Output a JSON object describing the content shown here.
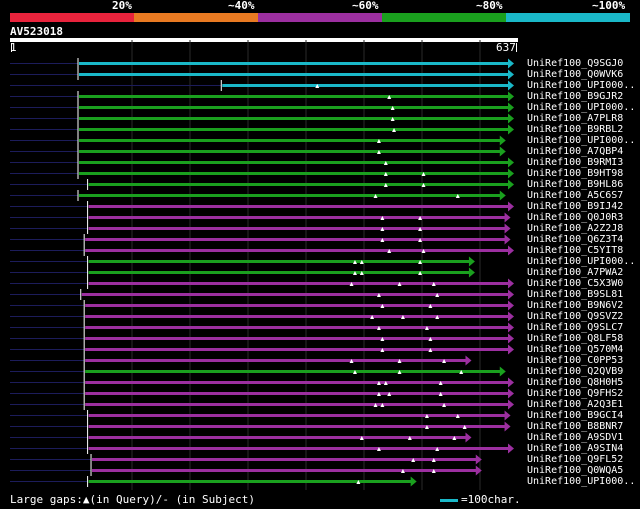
{
  "legend": {
    "labels": [
      "20%",
      "~40%",
      "~60%",
      "~80%",
      "~100%"
    ],
    "colors": [
      "#e8233c",
      "#e87a22",
      "#9c2fa0",
      "#1aa01e",
      "#1ab8c8"
    ]
  },
  "query": {
    "name": "AV523018",
    "start": "1",
    "end": "637"
  },
  "hits": [
    {
      "label": "UniRef100_Q9SGJ0",
      "color": "#1ab8c8",
      "start": 1,
      "end": 637,
      "marks": []
    },
    {
      "label": "UniRef100_Q0WVK6",
      "color": "#1ab8c8",
      "start": 1,
      "end": 637,
      "marks": []
    },
    {
      "label": "UniRef100_UPI000..",
      "color": "#1ab8c8",
      "start": 210,
      "end": 637,
      "marks": [
        350
      ]
    },
    {
      "label": "UniRef100_B9GJR2",
      "color": "#1aa01e",
      "start": 1,
      "end": 637,
      "marks": [
        455
      ]
    },
    {
      "label": "UniRef100_UPI000..",
      "color": "#1aa01e",
      "start": 1,
      "end": 637,
      "marks": [
        460
      ]
    },
    {
      "label": "UniRef100_A7PLR8",
      "color": "#1aa01e",
      "start": 1,
      "end": 637,
      "marks": [
        460
      ]
    },
    {
      "label": "UniRef100_B9RBL2",
      "color": "#1aa01e",
      "start": 1,
      "end": 637,
      "marks": [
        462
      ]
    },
    {
      "label": "UniRef100_UPI000..",
      "color": "#1aa01e",
      "start": 1,
      "end": 625,
      "marks": [
        440
      ]
    },
    {
      "label": "UniRef100_A7QBP4",
      "color": "#1aa01e",
      "start": 1,
      "end": 625,
      "marks": [
        440
      ]
    },
    {
      "label": "UniRef100_B9RMI3",
      "color": "#1aa01e",
      "start": 1,
      "end": 637,
      "marks": [
        450
      ]
    },
    {
      "label": "UniRef100_B9HT98",
      "color": "#1aa01e",
      "start": 1,
      "end": 637,
      "marks": [
        450,
        505
      ]
    },
    {
      "label": "UniRef100_B9HL86",
      "color": "#1aa01e",
      "start": 15,
      "end": 637,
      "marks": [
        450,
        505
      ]
    },
    {
      "label": "UniRef100_A5C6S7",
      "color": "#1aa01e",
      "start": 1,
      "end": 625,
      "marks": [
        435,
        555
      ]
    },
    {
      "label": "UniRef100_B9IJ42",
      "color": "#9c2fa0",
      "start": 15,
      "end": 637,
      "marks": []
    },
    {
      "label": "UniRef100_Q0J0R3",
      "color": "#9c2fa0",
      "start": 15,
      "end": 632,
      "marks": [
        445,
        500
      ]
    },
    {
      "label": "UniRef100_A2Z2J8",
      "color": "#9c2fa0",
      "start": 15,
      "end": 632,
      "marks": [
        445,
        500
      ]
    },
    {
      "label": "UniRef100_Q6Z3T4",
      "color": "#9c2fa0",
      "start": 10,
      "end": 632,
      "marks": [
        445,
        500
      ]
    },
    {
      "label": "UniRef100_C5YIT8",
      "color": "#9c2fa0",
      "start": 10,
      "end": 637,
      "marks": [
        455,
        505
      ]
    },
    {
      "label": "UniRef100_UPI000..",
      "color": "#1aa01e",
      "start": 15,
      "end": 580,
      "marks": [
        405,
        415,
        500
      ]
    },
    {
      "label": "UniRef100_A7PWA2",
      "color": "#1aa01e",
      "start": 15,
      "end": 580,
      "marks": [
        405,
        415,
        500
      ]
    },
    {
      "label": "UniRef100_C5X3W0",
      "color": "#9c2fa0",
      "start": 15,
      "end": 637,
      "marks": [
        400,
        470,
        520
      ]
    },
    {
      "label": "UniRef100_B9SL81",
      "color": "#9c2fa0",
      "start": 5,
      "end": 637,
      "marks": [
        440,
        525
      ]
    },
    {
      "label": "UniRef100_B9N6V2",
      "color": "#9c2fa0",
      "start": 10,
      "end": 637,
      "marks": [
        445,
        515
      ]
    },
    {
      "label": "UniRef100_Q9SVZ2",
      "color": "#9c2fa0",
      "start": 10,
      "end": 637,
      "marks": [
        430,
        475,
        525
      ]
    },
    {
      "label": "UniRef100_Q9SLC7",
      "color": "#9c2fa0",
      "start": 10,
      "end": 637,
      "marks": [
        440,
        510
      ]
    },
    {
      "label": "UniRef100_Q8LF58",
      "color": "#9c2fa0",
      "start": 10,
      "end": 637,
      "marks": [
        445,
        515
      ]
    },
    {
      "label": "UniRef100_Q570M4",
      "color": "#9c2fa0",
      "start": 10,
      "end": 637,
      "marks": [
        445,
        515
      ]
    },
    {
      "label": "UniRef100_C0PP53",
      "color": "#9c2fa0",
      "start": 10,
      "end": 575,
      "marks": [
        400,
        470,
        535
      ]
    },
    {
      "label": "UniRef100_Q2QVB9",
      "color": "#1aa01e",
      "start": 10,
      "end": 625,
      "marks": [
        405,
        470,
        560
      ]
    },
    {
      "label": "UniRef100_Q8H0H5",
      "color": "#9c2fa0",
      "start": 10,
      "end": 637,
      "marks": [
        440,
        450,
        530
      ]
    },
    {
      "label": "UniRef100_Q9FHS2",
      "color": "#9c2fa0",
      "start": 10,
      "end": 637,
      "marks": [
        440,
        455,
        530
      ]
    },
    {
      "label": "UniRef100_A2Q3E1",
      "color": "#9c2fa0",
      "start": 10,
      "end": 637,
      "marks": [
        435,
        445,
        535
      ]
    },
    {
      "label": "UniRef100_B9GCI4",
      "color": "#9c2fa0",
      "start": 15,
      "end": 632,
      "marks": [
        510,
        555
      ]
    },
    {
      "label": "UniRef100_B8BNR7",
      "color": "#9c2fa0",
      "start": 15,
      "end": 632,
      "marks": [
        510,
        565
      ]
    },
    {
      "label": "UniRef100_A9SDV1",
      "color": "#9c2fa0",
      "start": 15,
      "end": 575,
      "marks": [
        415,
        485,
        550
      ]
    },
    {
      "label": "UniRef100_A9SIN4",
      "color": "#9c2fa0",
      "start": 15,
      "end": 637,
      "marks": [
        440,
        525
      ]
    },
    {
      "label": "UniRef100_Q9FL52",
      "color": "#9c2fa0",
      "start": 20,
      "end": 590,
      "marks": [
        490,
        520
      ]
    },
    {
      "label": "UniRef100_Q0WQA5",
      "color": "#9c2fa0",
      "start": 20,
      "end": 590,
      "marks": [
        475,
        520
      ]
    },
    {
      "label": "UniRef100_UPI000..",
      "color": "#1aa01e",
      "start": 15,
      "end": 495,
      "marks": [
        410
      ]
    }
  ],
  "footer": {
    "large_gaps_text": "Large gaps:▲(in Query)/- (in Subject)",
    "scale_color": "#1ab8c8",
    "scale_text": "=100char."
  }
}
